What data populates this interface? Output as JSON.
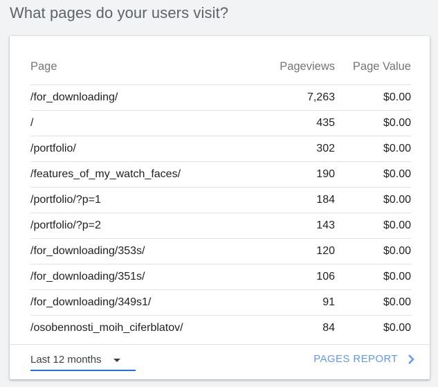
{
  "page_title": "What pages do your users visit?",
  "table": {
    "headers": {
      "page": "Page",
      "pageviews": "Pageviews",
      "page_value": "Page Value"
    },
    "rows": [
      {
        "page": "/for_downloading/",
        "pageviews": "7,263",
        "page_value": "$0.00"
      },
      {
        "page": "/",
        "pageviews": "435",
        "page_value": "$0.00"
      },
      {
        "page": "/portfolio/",
        "pageviews": "302",
        "page_value": "$0.00"
      },
      {
        "page": "/features_of_my_watch_faces/",
        "pageviews": "190",
        "page_value": "$0.00"
      },
      {
        "page": "/portfolio/?p=1",
        "pageviews": "184",
        "page_value": "$0.00"
      },
      {
        "page": "/portfolio/?p=2",
        "pageviews": "143",
        "page_value": "$0.00"
      },
      {
        "page": "/for_downloading/353s/",
        "pageviews": "120",
        "page_value": "$0.00"
      },
      {
        "page": "/for_downloading/351s/",
        "pageviews": "106",
        "page_value": "$0.00"
      },
      {
        "page": "/for_downloading/349s1/",
        "pageviews": "91",
        "page_value": "$0.00"
      },
      {
        "page": "/osobennosti_moih_ciferblatov/",
        "pageviews": "84",
        "page_value": "$0.00"
      }
    ]
  },
  "footer": {
    "date_range": "Last 12 months",
    "report_link": "PAGES REPORT",
    "icons": {
      "dropdown": "chevron-down-icon",
      "link": "chevron-right-icon"
    }
  },
  "colors": {
    "accent": "#1a73e8",
    "link": "#5e97f6",
    "background": "#f1f3f4"
  }
}
